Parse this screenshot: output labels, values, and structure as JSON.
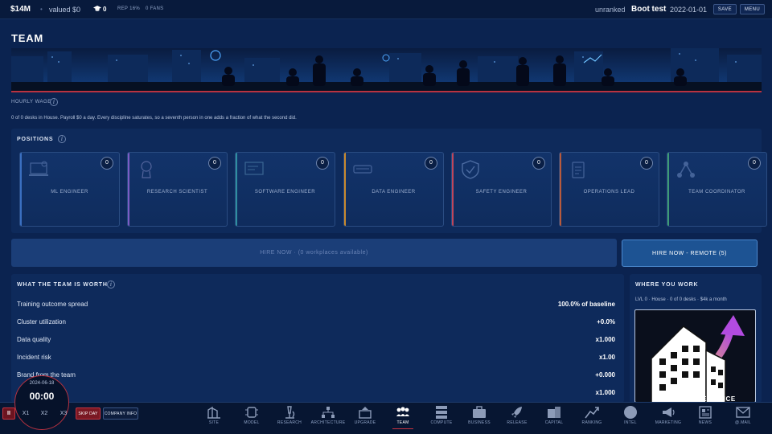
{
  "topbar": {
    "money": "$14M",
    "valued": "valued $0",
    "compute_count": "0",
    "rep": "REP 16%",
    "fans": "0 FANS",
    "rank": "unranked",
    "company": "Boot test",
    "date": "2022-01-01",
    "save_label": "SAVE",
    "menu_label": "MENU"
  },
  "page": {
    "title": "TEAM",
    "hourly_wage_label": "HOURLY WAGE",
    "desk_note": "0 of 0 desks in House. Payroll $0 a day. Every discipline saturates, so a seventh person in one adds a fraction of what the second did."
  },
  "positions": {
    "title": "POSITIONS",
    "items": [
      {
        "label": "ML ENGINEER",
        "count": "0",
        "accent": "#3a6fc0"
      },
      {
        "label": "RESEARCH SCIENTIST",
        "count": "0",
        "accent": "#7c5cc4"
      },
      {
        "label": "SOFTWARE ENGINEER",
        "count": "0",
        "accent": "#2f8fa0"
      },
      {
        "label": "DATA ENGINEER",
        "count": "0",
        "accent": "#c98a2e"
      },
      {
        "label": "SAFETY ENGINEER",
        "count": "0",
        "accent": "#c0465a"
      },
      {
        "label": "OPERATIONS LEAD",
        "count": "0",
        "accent": "#b85a3c"
      },
      {
        "label": "TEAM COORDINATOR",
        "count": "0",
        "accent": "#3e9b74"
      }
    ]
  },
  "hire": {
    "onsite_label": "HIRE NOW · (0 workplaces available)",
    "remote_label": "HIRE NOW - REMOTE (5)"
  },
  "worth": {
    "title": "WHAT THE TEAM IS WORTH",
    "rows": [
      {
        "label": "Training outcome spread",
        "value": "100.0% of baseline"
      },
      {
        "label": "Cluster utilization",
        "value": "+0.0%"
      },
      {
        "label": "Data quality",
        "value": "x1.000"
      },
      {
        "label": "Incident risk",
        "value": "x1.00"
      },
      {
        "label": "Brand from the team",
        "value": "+0.000"
      },
      {
        "label": "",
        "value": "x1.000"
      }
    ]
  },
  "work": {
    "title": "WHERE YOU WORK",
    "subtitle": "LVL 0 · House · 0 of 0 desks · $4k a month",
    "image_caption": "UPGRADE THE OFFICE"
  },
  "clock": {
    "date": "2024-06-18",
    "time": "00:00"
  },
  "controls": {
    "pause": "II",
    "x1": "X1",
    "x2": "X2",
    "x3": "X3",
    "skip": "SKIP DAY",
    "company_info": "COMPANY INFO"
  },
  "nav": [
    {
      "label": "SITE",
      "icon": "site-icon"
    },
    {
      "label": "MODEL",
      "icon": "model-icon"
    },
    {
      "label": "RESEARCH",
      "icon": "microscope-icon"
    },
    {
      "label": "ARCHITECTURE",
      "icon": "architecture-icon"
    },
    {
      "label": "UPGRADE",
      "icon": "upgrade-icon"
    },
    {
      "label": "TEAM",
      "icon": "team-icon"
    },
    {
      "label": "COMPUTE",
      "icon": "server-icon"
    },
    {
      "label": "BUSINESS",
      "icon": "briefcase-icon"
    },
    {
      "label": "RELEASE",
      "icon": "rocket-icon"
    },
    {
      "label": "CAPITAL",
      "icon": "capital-icon"
    },
    {
      "label": "RANKING",
      "icon": "ranking-icon"
    },
    {
      "label": "INTEL",
      "icon": "intel-icon"
    },
    {
      "label": "MARKETING",
      "icon": "megaphone-icon"
    },
    {
      "label": "NEWS",
      "icon": "newspaper-icon"
    },
    {
      "label": "@.MAIL",
      "icon": "mail-icon"
    }
  ],
  "colors": {
    "background": "#0b2350",
    "panel": "#0e2a5b",
    "accent_red": "#c7333f",
    "remote_button": "#1d5393"
  }
}
